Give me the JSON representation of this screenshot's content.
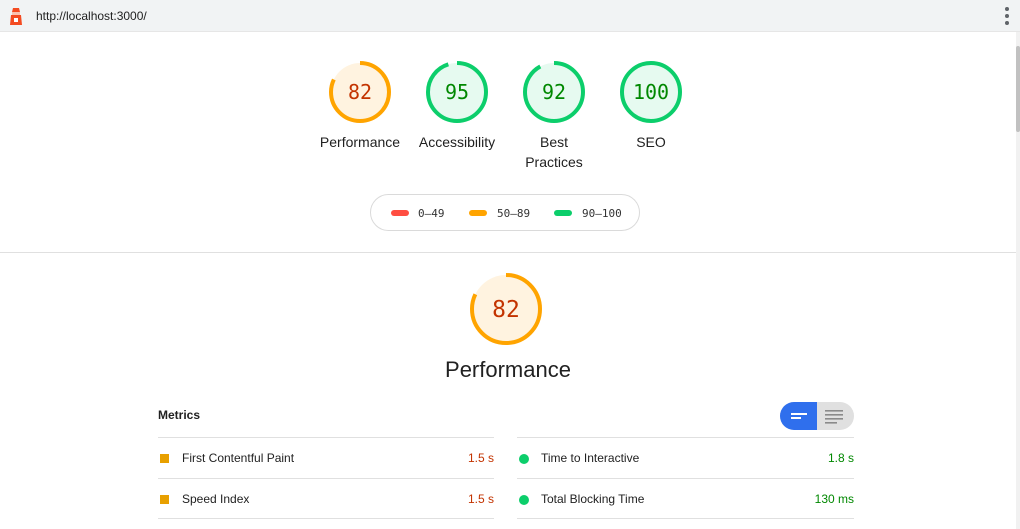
{
  "browser": {
    "url": "http://localhost:3000/"
  },
  "gauges": [
    {
      "score": "82",
      "label": "Performance",
      "fraction": 0.82,
      "color": "#ffa400",
      "bg": "#fff3e0",
      "text_color": "#c33300"
    },
    {
      "score": "95",
      "label": "Accessibility",
      "fraction": 0.95,
      "color": "#0cce6b",
      "bg": "#e6faf0",
      "text_color": "#008800"
    },
    {
      "score": "92",
      "label": "Best Practices",
      "fraction": 0.92,
      "color": "#0cce6b",
      "bg": "#e6faf0",
      "text_color": "#008800"
    },
    {
      "score": "100",
      "label": "SEO",
      "fraction": 1.0,
      "color": "#0cce6b",
      "bg": "#e6faf0",
      "text_color": "#008800"
    }
  ],
  "legend": {
    "fail": {
      "label": "0–49",
      "color": "#ff4e42"
    },
    "average": {
      "label": "50–89",
      "color": "#ffa400"
    },
    "pass": {
      "label": "90–100",
      "color": "#0cce6b"
    }
  },
  "performance": {
    "score": "82",
    "fraction": 0.82,
    "title": "Performance",
    "metrics_heading": "Metrics",
    "view_toggle": {
      "icons": [
        "compact-view-icon",
        "expanded-view-icon"
      ],
      "active": "compact"
    },
    "metrics": [
      {
        "name": "First Contentful Paint",
        "value": "1.5 s",
        "status": "average"
      },
      {
        "name": "Time to Interactive",
        "value": "1.8 s",
        "status": "pass"
      },
      {
        "name": "Speed Index",
        "value": "1.5 s",
        "status": "average"
      },
      {
        "name": "Total Blocking Time",
        "value": "130 ms",
        "status": "pass"
      }
    ]
  },
  "colors": {
    "average_text": "#c33300",
    "pass_text": "#008800",
    "toggle_active": "#2f6fed"
  }
}
